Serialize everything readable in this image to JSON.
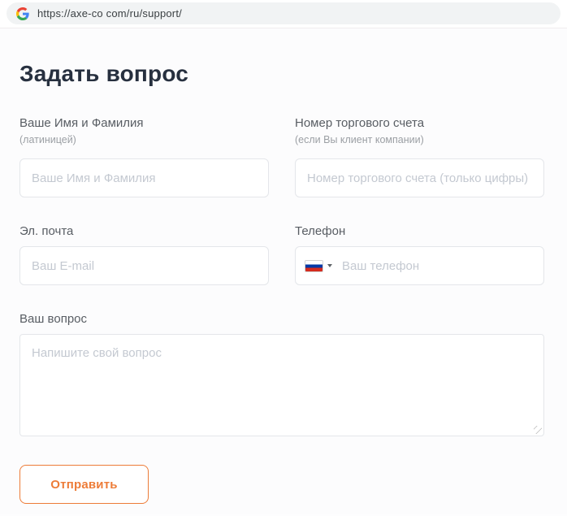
{
  "browser": {
    "url": "https://axe-co com/ru/support/",
    "icon": "google-g-icon"
  },
  "page": {
    "title": "Задать вопрос"
  },
  "form": {
    "fields": {
      "name": {
        "label": "Ваше Имя и Фамилия",
        "sublabel": "(латиницей)",
        "placeholder": "Ваше Имя и Фамилия",
        "value": ""
      },
      "account": {
        "label": "Номер торгового счета",
        "sublabel": "(если Вы клиент компании)",
        "placeholder": "Номер торгового счета (только цифры)",
        "value": ""
      },
      "email": {
        "label": "Эл. почта",
        "placeholder": "Ваш E-mail",
        "value": ""
      },
      "phone": {
        "label": "Телефон",
        "placeholder": "Ваш телефон",
        "value": "",
        "country_flag_icon": "ru-flag-icon",
        "dropdown_icon": "chevron-down-icon"
      },
      "question": {
        "label": "Ваш вопрос",
        "placeholder": "Напишите свой вопрос",
        "value": ""
      }
    },
    "submit_label": "Отправить"
  },
  "colors": {
    "accent_orange": "#ed7c38",
    "title_text": "#27303f",
    "label_text": "#585d63",
    "sublabel_text": "#9b9fa4",
    "placeholder_text": "#c4c9d1",
    "input_border": "#e4e6ea",
    "urlbar_bg": "#f1f3f4",
    "flag_white": "#ffffff",
    "flag_blue": "#0039a6",
    "flag_red": "#d52b1e"
  }
}
